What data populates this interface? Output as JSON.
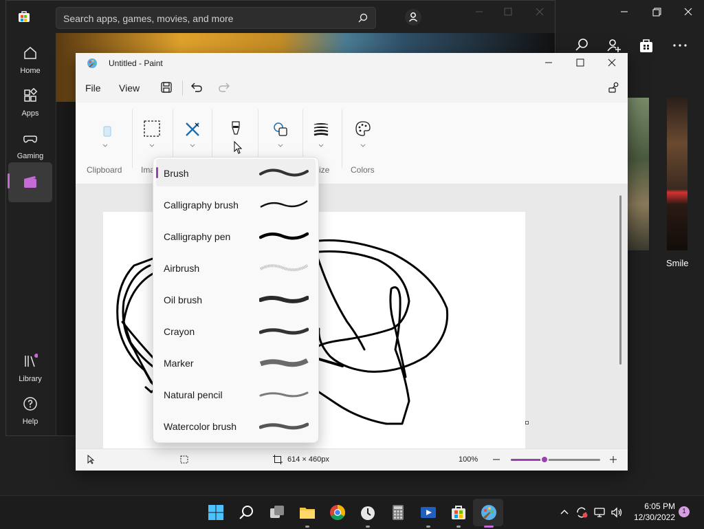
{
  "store": {
    "search_placeholder": "Search apps, games, movies, and more",
    "nav": [
      {
        "label": "Home",
        "icon": "home-icon"
      },
      {
        "label": "Apps",
        "icon": "apps-icon"
      },
      {
        "label": "Gaming",
        "icon": "gaming-icon"
      },
      {
        "label": "",
        "icon": "movies-icon"
      },
      {
        "label": "Library",
        "icon": "library-icon"
      },
      {
        "label": "Help",
        "icon": "help-icon"
      }
    ],
    "side_card_title": "Smile",
    "accent": "#c56bd6"
  },
  "paint": {
    "window_title": "Untitled - Paint",
    "menu": {
      "file": "File",
      "view": "View"
    },
    "ribbon": {
      "clipboard": "Clipboard",
      "image_partial": "Ima",
      "size_partial": "ize",
      "colors": "Colors"
    },
    "brush_menu": {
      "selected_index": 0,
      "items": [
        {
          "label": "Brush",
          "style": "brush"
        },
        {
          "label": "Calligraphy brush",
          "style": "calligraphy-brush"
        },
        {
          "label": "Calligraphy pen",
          "style": "calligraphy-pen"
        },
        {
          "label": "Airbrush",
          "style": "airbrush"
        },
        {
          "label": "Oil brush",
          "style": "oil-brush"
        },
        {
          "label": "Crayon",
          "style": "crayon"
        },
        {
          "label": "Marker",
          "style": "marker"
        },
        {
          "label": "Natural pencil",
          "style": "natural-pencil"
        },
        {
          "label": "Watercolor brush",
          "style": "watercolor-brush"
        }
      ]
    },
    "status": {
      "canvas_size": "614 × 460px",
      "zoom": "100%",
      "zoom_level_fraction": 0.38
    },
    "accent": "#9a3fae"
  },
  "taskbar": {
    "apps": [
      "start-icon",
      "search-icon",
      "task-view-icon",
      "file-explorer-icon",
      "chrome-icon",
      "clock-app-icon",
      "calculator-icon",
      "media-player-icon",
      "store-icon",
      "paint-icon"
    ],
    "time": "6:05 PM",
    "date": "12/30/2022",
    "notification_count": "1"
  }
}
